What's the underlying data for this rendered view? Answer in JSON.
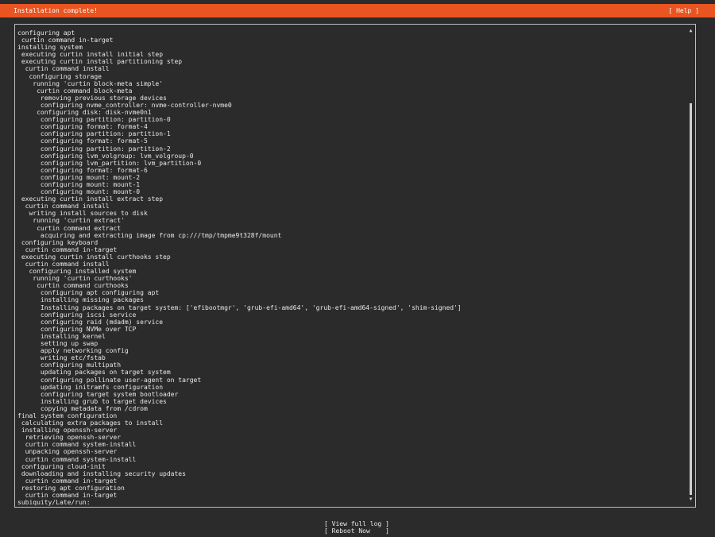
{
  "header": {
    "title": "Installation complete!",
    "help_label": "[ Help ]"
  },
  "log": {
    "lines": [
      "configuring apt",
      " curtin command in-target",
      "installing system",
      " executing curtin install initial step",
      " executing curtin install partitioning step",
      "  curtin command install",
      "   configuring storage",
      "    running 'curtin block-meta simple'",
      "     curtin command block-meta",
      "      removing previous storage devices",
      "      configuring nvme_controller: nvme-controller-nvme0",
      "     configuring disk: disk-nvme0n1",
      "      configuring partition: partition-0",
      "      configuring format: format-4",
      "      configuring partition: partition-1",
      "      configuring format: format-5",
      "      configuring partition: partition-2",
      "      configuring lvm_volgroup: lvm_volgroup-0",
      "      configuring lvm_partition: lvm_partition-0",
      "      configuring format: format-6",
      "      configuring mount: mount-2",
      "      configuring mount: mount-1",
      "      configuring mount: mount-0",
      " executing curtin install extract step",
      "  curtin command install",
      "   writing install sources to disk",
      "    running 'curtin extract'",
      "     curtin command extract",
      "      acquiring and extracting image from cp:///tmp/tmpme9t328f/mount",
      " configuring keyboard",
      "  curtin command in-target",
      " executing curtin install curthooks step",
      "  curtin command install",
      "   configuring installed system",
      "    running 'curtin curthooks'",
      "     curtin command curthooks",
      "      configuring apt configuring apt",
      "      installing missing packages",
      "      Installing packages on target system: ['efibootmgr', 'grub-efi-amd64', 'grub-efi-amd64-signed', 'shim-signed']",
      "      configuring iscsi service",
      "      configuring raid (mdadm) service",
      "      configuring NVMe over TCP",
      "      installing kernel",
      "      setting up swap",
      "      apply networking config",
      "      writing etc/fstab",
      "      configuring multipath",
      "      updating packages on target system",
      "      configuring pollinate user-agent on target",
      "      updating initramfs configuration",
      "      configuring target system bootloader",
      "      installing grub to target devices",
      "      copying metadata from /cdrom",
      "final system configuration",
      " calculating extra packages to install",
      " installing openssh-server",
      "  retrieving openssh-server",
      "  curtin command system-install",
      "  unpacking openssh-server",
      "  curtin command system-install",
      " configuring cloud-init",
      " downloading and installing security updates",
      "  curtin command in-target",
      " restoring apt configuration",
      "  curtin command in-target",
      "subiquity/Late/run:"
    ]
  },
  "scrollbar": {
    "up_arrow": "▲",
    "down_arrow": "▼"
  },
  "footer": {
    "view_log_label": "[ View full log ]",
    "reboot_label": "[ Reboot Now    ]"
  },
  "colors": {
    "header_bg": "#e95420",
    "background": "#2b2b2b",
    "text": "#e6e6e6"
  }
}
